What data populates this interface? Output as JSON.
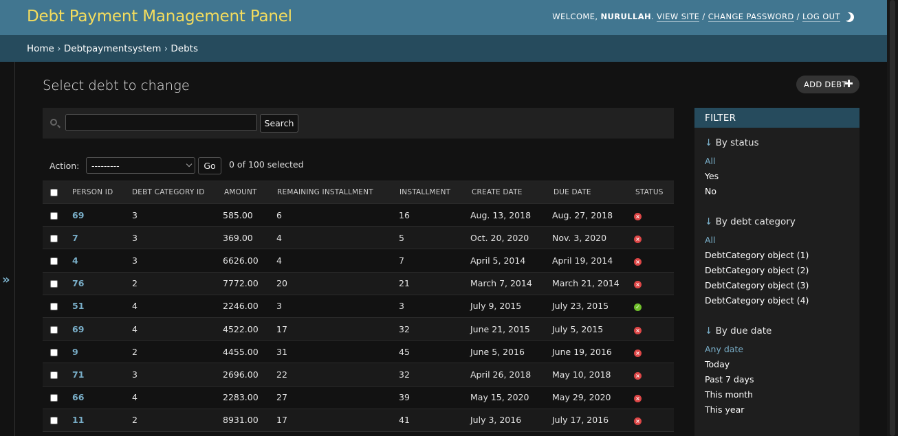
{
  "header": {
    "site_title": "Debt Payment Management Panel",
    "welcome": "WELCOME,",
    "username": "NURULLAH",
    "view_site": "VIEW SITE",
    "change_password": "CHANGE PASSWORD",
    "log_out": "LOG OUT"
  },
  "breadcrumbs": {
    "home": "Home",
    "app": "Debtpaymentsystem",
    "current": "Debts",
    "sep": "›"
  },
  "page": {
    "title": "Select debt to change",
    "add_label": "ADD DEBT"
  },
  "search": {
    "value": "",
    "button": "Search"
  },
  "actions": {
    "label": "Action:",
    "selected_option": "---------",
    "go": "Go",
    "selected_count": "0 of 100 selected"
  },
  "table": {
    "headers": [
      "PERSON ID",
      "DEBT CATEGORY ID",
      "AMOUNT",
      "REMAINING INSTALLMENT",
      "INSTALLMENT",
      "CREATE DATE",
      "DUE DATE",
      "STATUS"
    ],
    "rows": [
      {
        "person_id": "69",
        "category": "3",
        "amount": "585.00",
        "remaining": "6",
        "installment": "16",
        "create": "Aug. 13, 2018",
        "due": "Aug. 27, 2018",
        "status": "no"
      },
      {
        "person_id": "7",
        "category": "3",
        "amount": "369.00",
        "remaining": "4",
        "installment": "5",
        "create": "Oct. 20, 2020",
        "due": "Nov. 3, 2020",
        "status": "no"
      },
      {
        "person_id": "4",
        "category": "3",
        "amount": "6626.00",
        "remaining": "4",
        "installment": "7",
        "create": "April 5, 2014",
        "due": "April 19, 2014",
        "status": "no"
      },
      {
        "person_id": "76",
        "category": "2",
        "amount": "7772.00",
        "remaining": "20",
        "installment": "21",
        "create": "March 7, 2014",
        "due": "March 21, 2014",
        "status": "no"
      },
      {
        "person_id": "51",
        "category": "4",
        "amount": "2246.00",
        "remaining": "3",
        "installment": "3",
        "create": "July 9, 2015",
        "due": "July 23, 2015",
        "status": "yes"
      },
      {
        "person_id": "69",
        "category": "4",
        "amount": "4522.00",
        "remaining": "17",
        "installment": "32",
        "create": "June 21, 2015",
        "due": "July 5, 2015",
        "status": "no"
      },
      {
        "person_id": "9",
        "category": "2",
        "amount": "4455.00",
        "remaining": "31",
        "installment": "45",
        "create": "June 5, 2016",
        "due": "June 19, 2016",
        "status": "no"
      },
      {
        "person_id": "71",
        "category": "3",
        "amount": "2696.00",
        "remaining": "22",
        "installment": "32",
        "create": "April 26, 2018",
        "due": "May 10, 2018",
        "status": "no"
      },
      {
        "person_id": "66",
        "category": "4",
        "amount": "2283.00",
        "remaining": "27",
        "installment": "39",
        "create": "May 15, 2020",
        "due": "May 29, 2020",
        "status": "no"
      },
      {
        "person_id": "11",
        "category": "2",
        "amount": "8931.00",
        "remaining": "17",
        "installment": "41",
        "create": "July 3, 2016",
        "due": "July 17, 2016",
        "status": "no"
      }
    ]
  },
  "filter": {
    "title": "FILTER",
    "sections": [
      {
        "heading": "By status",
        "items": [
          "All",
          "Yes",
          "No"
        ]
      },
      {
        "heading": "By debt category",
        "items": [
          "All",
          "DebtCategory object (1)",
          "DebtCategory object (2)",
          "DebtCategory object (3)",
          "DebtCategory object (4)"
        ]
      },
      {
        "heading": "By due date",
        "items": [
          "Any date",
          "Today",
          "Past 7 days",
          "This month",
          "This year"
        ]
      }
    ]
  },
  "colors": {
    "header_bg": "#417690",
    "title": "#f5dd5d",
    "breadcrumb_bg": "#264b5d",
    "link": "#79aec8",
    "status_no": "#dd4646",
    "status_yes": "#70bf2b"
  }
}
